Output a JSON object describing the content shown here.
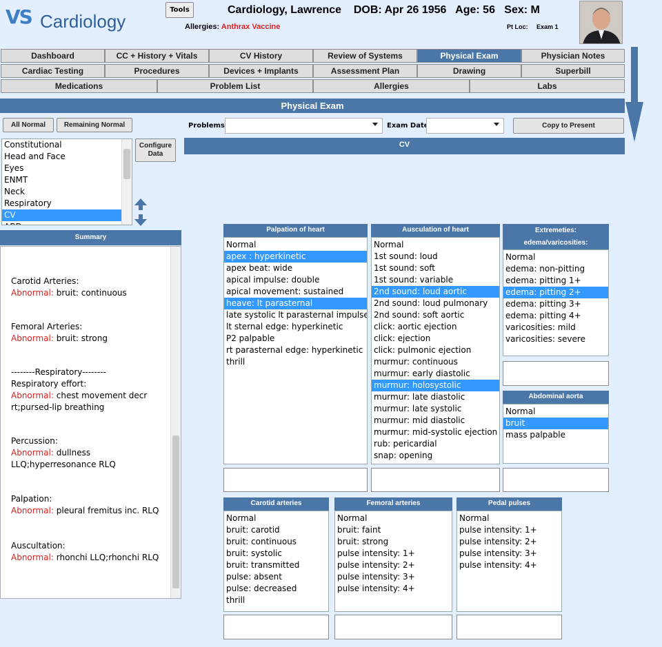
{
  "app": {
    "logo": "VS",
    "name": "Cardiology"
  },
  "header": {
    "tools_label": "Tools",
    "patient_line": "Cardiology, Lawrence    DOB: Apr 26 1956   Age: 56   Sex: M",
    "allergies_label": "Allergies:",
    "allergies_value": "Anthrax Vaccine",
    "pt_loc_label": "Pt Loc:",
    "pt_loc_value": "Exam 1"
  },
  "tabs_row1": [
    "Dashboard",
    "CC + History + Vitals",
    "CV History",
    "Review of Systems",
    "Physical Exam",
    "Physician Notes"
  ],
  "tabs_row2": [
    "Cardiac Testing",
    "Procedures",
    "Devices + Implants",
    "Assessment Plan",
    "Drawing",
    "Superbill"
  ],
  "tabs_row3": [
    "Medications",
    "Problem List",
    "Allergies",
    "Labs"
  ],
  "active_tab": "Physical Exam",
  "section_title": "Physical Exam",
  "toolbar": {
    "all_normal": "All Normal",
    "remaining_normal": "Remaining Normal",
    "problems_label": "Problems:",
    "problems_value": "",
    "exam_date_label": "Exam Date:",
    "exam_date_value": "",
    "copy_to_present": "Copy to Present",
    "configure_data": "Configure Data"
  },
  "systems": [
    "Constitutional",
    "Head and Face",
    "Eyes",
    "ENMT",
    "Neck",
    "Respiratory",
    "CV",
    "ABD"
  ],
  "selected_system": "CV",
  "current_system_title": "CV",
  "summary": {
    "title": "Summary",
    "entries": [
      {
        "heading": "Carotid Arteries:",
        "abnormal_label": "Abnormal:",
        "text": " bruit: continuous"
      },
      {
        "heading": "Femoral Arteries:",
        "abnormal_label": "Abnormal:",
        "text": " bruit: strong"
      },
      {
        "heading": "--------Respiratory--------\nRespiratory effort:",
        "abnormal_label": "Abnormal:",
        "text": " chest movement decr rt;pursed-lip breathing"
      },
      {
        "heading": "Percussion:",
        "abnormal_label": "Abnormal:",
        "text": " dullness LLQ;hyperresonance RLQ"
      },
      {
        "heading": "Palpation:",
        "abnormal_label": "Abnormal:",
        "text": " pleural fremitus inc. RLQ"
      },
      {
        "heading": "Auscultation:",
        "abnormal_label": "Abnormal:",
        "text": " rhonchi LLQ;rhonchi RLQ"
      }
    ]
  },
  "panels": {
    "palpation": {
      "title": "Palpation of heart",
      "items": [
        "Normal",
        "apex : hyperkinetic",
        "apex beat: wide",
        "apical impulse: double",
        "apical movement: sustained",
        "heave: lt parasternal",
        "late systolic lt parasternal impulse",
        "lt sternal edge: hyperkinetic",
        "P2 palpable",
        "rt parasternal edge: hyperkinetic",
        "thrill"
      ],
      "selected": [
        1,
        5
      ]
    },
    "auscultation": {
      "title": "Ausculation of heart",
      "items": [
        "Normal",
        "1st sound: loud",
        "1st sound: soft",
        "1st sound: variable",
        "2nd sound: loud aortic",
        "2nd sound: loud pulmonary",
        "2nd sound: soft aortic",
        "click: aortic ejection",
        "click: ejection",
        "click: pulmonic ejection",
        "murmur: continuous",
        "murmur: early diastolic",
        "murmur: holosystolic",
        "murmur: late diastolic",
        "murmur: late systolic",
        "murmur: mid diastolic",
        "murmur: mid-systolic ejection",
        "rub: pericardial",
        "snap: opening"
      ],
      "selected": [
        4,
        12
      ]
    },
    "extremeties": {
      "title": "Extremeties: edema/varicosities:",
      "items": [
        "Normal",
        "edema: non-pitting",
        "edema: pitting 1+",
        "edema: pitting 2+",
        "edema: pitting 3+",
        "edema: pitting 4+",
        "varicosities: mild",
        "varicosities: severe"
      ],
      "selected": [
        3
      ]
    },
    "abdominal_aorta": {
      "title": "Abdominal aorta",
      "items": [
        "Normal",
        "bruit",
        "mass palpable"
      ],
      "selected": [
        1
      ]
    },
    "carotid": {
      "title": "Carotid arteries",
      "items": [
        "Normal",
        "bruit: carotid",
        "bruit: continuous",
        "bruit: systolic",
        "bruit: transmitted",
        "pulse: absent",
        "pulse: decreased",
        "thrill"
      ],
      "selected": []
    },
    "femoral": {
      "title": "Femoral arteries",
      "items": [
        "Normal",
        "bruit: faint",
        "bruit: strong",
        "pulse intensity: 1+",
        "pulse intensity: 2+",
        "pulse intensity: 3+",
        "pulse intensity: 4+"
      ],
      "selected": []
    },
    "pedal": {
      "title": "Pedal pulses",
      "items": [
        "Normal",
        "pulse intensity: 1+",
        "pulse intensity: 2+",
        "pulse intensity: 3+",
        "pulse intensity: 4+"
      ],
      "selected": []
    }
  },
  "colors": {
    "accent": "#4a77a8",
    "selection": "#3399ff",
    "abnormal": "#e02020",
    "background": "#e3efff"
  }
}
